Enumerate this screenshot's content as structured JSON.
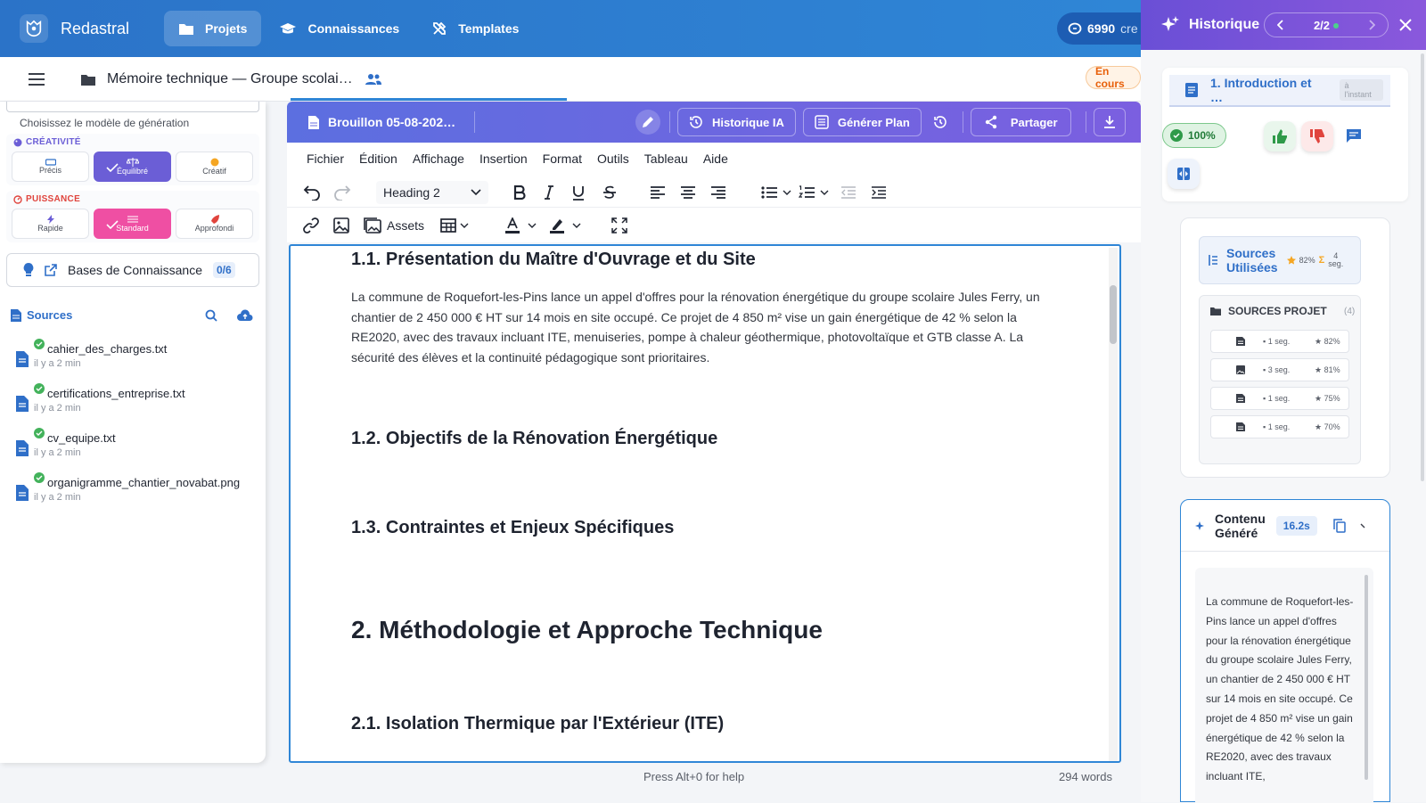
{
  "app": {
    "name": "Redastral"
  },
  "nav": [
    {
      "label": "Projets",
      "active": true,
      "icon": "folder-icon"
    },
    {
      "label": "Connaissances",
      "active": false,
      "icon": "graduation-cap-icon"
    },
    {
      "label": "Templates",
      "active": false,
      "icon": "tools-icon"
    }
  ],
  "credits": {
    "value": "6990",
    "unit": "cre"
  },
  "doc": {
    "title": "Mémoire technique — Groupe scolai…",
    "status": "En cours"
  },
  "generation": {
    "help": "Choisissez le modèle de génération",
    "creativity": {
      "title": "CRÉATIVITÉ",
      "options": [
        "Précis",
        "Équilibré",
        "Créatif"
      ],
      "selected": "Équilibré"
    },
    "power": {
      "title": "PUISSANCE",
      "options": [
        "Rapide",
        "Standard",
        "Approfondi"
      ],
      "selected": "Standard"
    }
  },
  "knowledge": {
    "label": "Bases de Connaissance",
    "count": "0/6"
  },
  "sources": {
    "title": "Sources",
    "items": [
      {
        "name": "cahier_des_charges.txt",
        "time": "il y a 2 min"
      },
      {
        "name": "certifications_entreprise.txt",
        "time": "il y a 2 min"
      },
      {
        "name": "cv_equipe.txt",
        "time": "il y a 2 min"
      },
      {
        "name": "organigramme_chantier_novabat.png",
        "time": "il y a 2 min"
      }
    ]
  },
  "editor": {
    "draft": "Brouillon 05-08-202…",
    "buttons": {
      "history": "Historique IA",
      "plan": "Générer Plan",
      "share": "Partager"
    },
    "menu": [
      "Fichier",
      "Édition",
      "Affichage",
      "Insertion",
      "Format",
      "Outils",
      "Tableau",
      "Aide"
    ],
    "heading_select": "Heading 2",
    "assets_label": "Assets",
    "help": "Press Alt+0 for help",
    "words": "294 words"
  },
  "content": {
    "h11": "1.1. Présentation du Maître d'Ouvrage et du Site",
    "p11": "La commune de Roquefort-les-Pins lance un appel d'offres pour la rénovation énergétique du groupe scolaire Jules Ferry, un chantier de 2 450 000 € HT sur 14 mois en site occupé. Ce projet de 4 850 m² vise un gain énergétique de 42 % selon la RE2020, avec des travaux incluant ITE, menuiseries, pompe à chaleur géothermique, photovoltaïque et GTB classe A. La sécurité des élèves et la continuité pédagogique sont prioritaires.",
    "h12": "1.2. Objectifs de la Rénovation Énergétique",
    "h13": "1.3. Contraintes et Enjeux Spécifiques",
    "h2": "2. Méthodologie et Approche Technique",
    "h21": "2.1. Isolation Thermique par l'Extérieur (ITE)"
  },
  "history": {
    "title": "Historique",
    "page": "2/2",
    "section": "1. Introduction et …",
    "when": "à l'instant",
    "score": "100%",
    "sources_used": {
      "title1": "Sources",
      "title2": "Utilisées",
      "score": "82%",
      "segs_num": "4",
      "segs_unit": "seg."
    },
    "project_sources": {
      "title": "SOURCES PROJET",
      "count": "(4)",
      "rows": [
        {
          "seg": "1 seg.",
          "score": "82%",
          "type": "doc"
        },
        {
          "seg": "3 seg.",
          "score": "81%",
          "type": "image"
        },
        {
          "seg": "1 seg.",
          "score": "75%",
          "type": "doc"
        },
        {
          "seg": "1 seg.",
          "score": "70%",
          "type": "doc"
        }
      ]
    },
    "generated": {
      "title1": "Contenu",
      "title2": "Généré",
      "time": "16.2s",
      "text": "La commune de Roquefort-les-Pins lance un appel d'offres pour la rénovation énergétique du groupe scolaire Jules Ferry, un chantier de 2 450 000 € HT sur 14 mois en site occupé. Ce projet de 4 850 m² vise un gain énergétique de 42 % selon la RE2020, avec des travaux incluant ITE,"
    }
  },
  "colors": {
    "primary": "#2f86d6",
    "accent_purple": "#6b5ed6",
    "accent_pink": "#ef4fa3",
    "status_orange": "#e8600a"
  }
}
